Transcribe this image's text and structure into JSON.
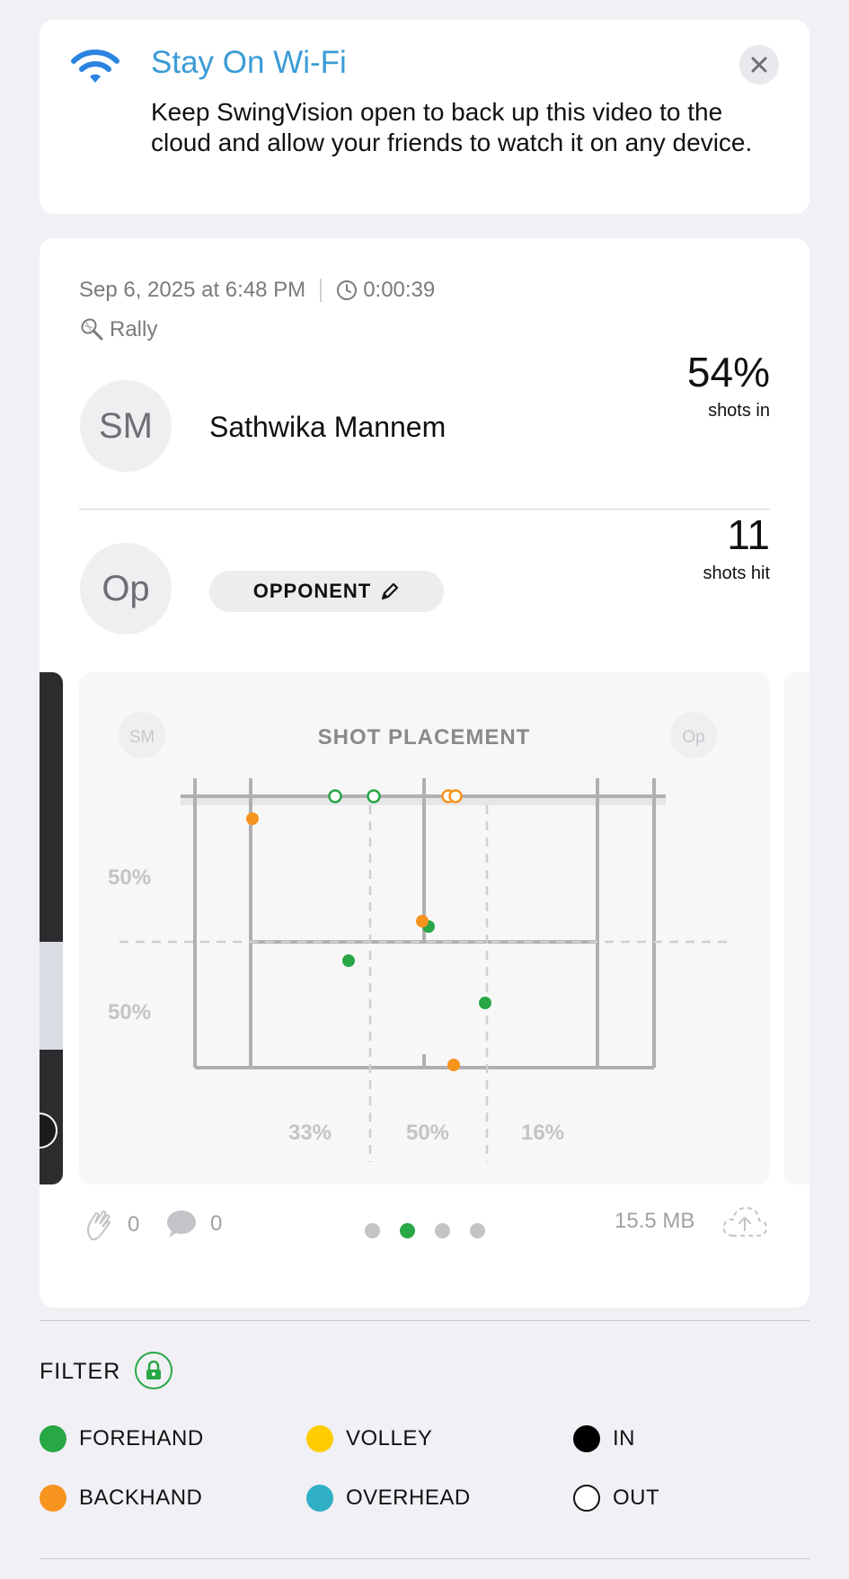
{
  "banner": {
    "title": "Stay On Wi-Fi",
    "body": "Keep SwingVision open to back up this video to the cloud and allow your friends to watch it on any device.",
    "icon": "wifi-icon",
    "close_icon": "close-icon",
    "title_color": "#3a9bd6"
  },
  "session": {
    "date": "Sep 6, 2025 at 6:48 PM",
    "duration": "0:00:39",
    "mode": "Rally"
  },
  "player": {
    "initials": "SM",
    "name": "Sathwika Mannem",
    "stat_value": "54%",
    "stat_label": "shots in"
  },
  "opponent": {
    "initials": "Op",
    "label": "OPPONENT",
    "stat_value": "11",
    "stat_label": "shots hit"
  },
  "shot_placement": {
    "title": "SHOT PLACEMENT",
    "left_badge": "SM",
    "right_badge": "Op",
    "depth_top": "50%",
    "depth_bottom": "50%",
    "col_left": "33%",
    "col_mid": "50%",
    "col_right": "16%",
    "colors": {
      "forehand": "#28a745",
      "backhand": "#f7941d"
    }
  },
  "footer": {
    "likes": "0",
    "comments": "0",
    "size": "15.5 MB",
    "page_index": 2,
    "page_count": 4
  },
  "filter": {
    "title": "FILTER",
    "items": [
      {
        "label": "FOREHAND",
        "color": "#28a745"
      },
      {
        "label": "VOLLEY",
        "color": "#ffcc00"
      },
      {
        "label": "IN",
        "color": "#000000"
      },
      {
        "label": "BACKHAND",
        "color": "#f7941d"
      },
      {
        "label": "OVERHEAD",
        "color": "#30b0c7"
      },
      {
        "label": "OUT",
        "color": "#ffffff"
      }
    ]
  }
}
